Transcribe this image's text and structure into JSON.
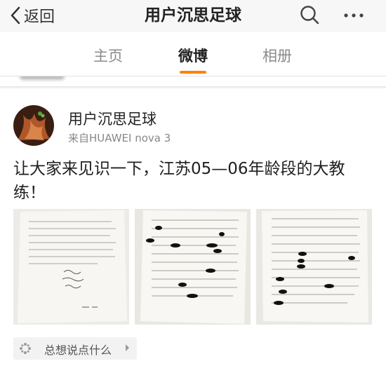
{
  "navbar": {
    "back_label": "返回",
    "title": "用户沉思足球",
    "search_icon": "search-icon",
    "more_icon": "more-icon"
  },
  "tabs": [
    {
      "label": "主页",
      "active": false
    },
    {
      "label": "微博",
      "active": true
    },
    {
      "label": "相册",
      "active": false
    }
  ],
  "colors": {
    "accent": "#ff8200"
  },
  "post": {
    "username": "用户沉思足球",
    "source": "来自HUAWEI nova 3",
    "text": "让大家来见识一下，江苏05—06年龄段的大教练！",
    "images": [
      "document-photo-1",
      "document-photo-2",
      "document-photo-3"
    ]
  },
  "comment": {
    "placeholder": "总想说点什么",
    "icon": "sparkle-icon"
  }
}
